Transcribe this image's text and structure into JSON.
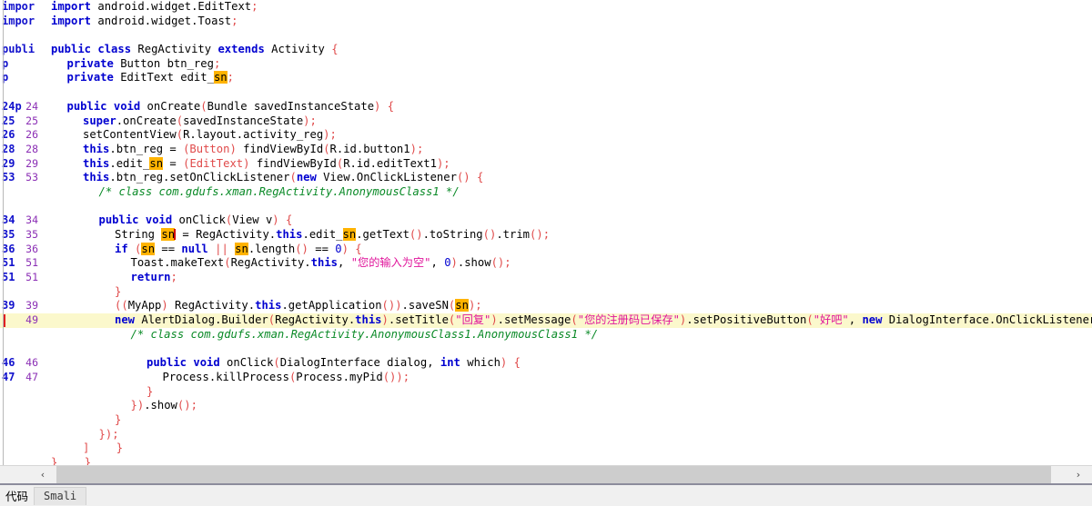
{
  "editor": {
    "ghost_gutter_lines": [
      "impor",
      "impor",
      "",
      "publi",
      "p",
      "p",
      "",
      "24p",
      "25",
      "26",
      "28",
      "29",
      "53",
      "",
      "",
      "34",
      "35",
      "36",
      "51",
      "51",
      "",
      "39",
      "49",
      "",
      "",
      "46",
      "47",
      "",
      "",
      "",
      "",
      "",
      "",
      ""
    ],
    "lines": [
      {
        "num": "",
        "indent": 0,
        "marker": false,
        "highlight": false,
        "tokens": [
          {
            "t": "kw",
            "v": "import"
          },
          {
            "t": "ident",
            "v": " android.widget.EditText"
          },
          {
            "t": "punc",
            "v": ";"
          }
        ]
      },
      {
        "num": "",
        "indent": 0,
        "marker": false,
        "highlight": false,
        "tokens": [
          {
            "t": "kw",
            "v": "import"
          },
          {
            "t": "ident",
            "v": " android.widget.Toast"
          },
          {
            "t": "punc",
            "v": ";"
          }
        ]
      },
      {
        "num": "",
        "indent": 0,
        "marker": false,
        "highlight": false,
        "tokens": []
      },
      {
        "num": "",
        "indent": 0,
        "marker": false,
        "highlight": false,
        "tokens": [
          {
            "t": "kw",
            "v": "public class"
          },
          {
            "t": "ident",
            "v": " RegActivity "
          },
          {
            "t": "kw",
            "v": "extends"
          },
          {
            "t": "ident",
            "v": " Activity "
          },
          {
            "t": "punc",
            "v": "{"
          }
        ]
      },
      {
        "num": "",
        "indent": 1,
        "marker": false,
        "highlight": false,
        "tokens": [
          {
            "t": "kw",
            "v": "private"
          },
          {
            "t": "ident",
            "v": " Button btn_reg"
          },
          {
            "t": "punc",
            "v": ";"
          }
        ]
      },
      {
        "num": "",
        "indent": 1,
        "marker": false,
        "highlight": false,
        "tokens": [
          {
            "t": "kw",
            "v": "private"
          },
          {
            "t": "ident",
            "v": " EditText edit_"
          },
          {
            "t": "hlvar",
            "v": "sn"
          },
          {
            "t": "punc",
            "v": ";"
          }
        ]
      },
      {
        "num": "",
        "indent": 0,
        "marker": false,
        "highlight": false,
        "tokens": []
      },
      {
        "num": "24",
        "indent": 1,
        "marker": false,
        "highlight": false,
        "tokens": [
          {
            "t": "kw",
            "v": "public void"
          },
          {
            "t": "ident",
            "v": " onCreate"
          },
          {
            "t": "punc",
            "v": "("
          },
          {
            "t": "ident",
            "v": "Bundle savedInstanceState"
          },
          {
            "t": "punc",
            "v": ")"
          },
          {
            "t": "ident",
            "v": " "
          },
          {
            "t": "punc",
            "v": "{"
          }
        ]
      },
      {
        "num": "25",
        "indent": 2,
        "marker": false,
        "highlight": false,
        "tokens": [
          {
            "t": "kw",
            "v": "super"
          },
          {
            "t": "ident",
            "v": ".onCreate"
          },
          {
            "t": "punc",
            "v": "("
          },
          {
            "t": "ident",
            "v": "savedInstanceState"
          },
          {
            "t": "punc",
            "v": ")"
          },
          {
            "t": "punc",
            "v": ";"
          }
        ]
      },
      {
        "num": "26",
        "indent": 2,
        "marker": false,
        "highlight": false,
        "tokens": [
          {
            "t": "ident",
            "v": "setContentView"
          },
          {
            "t": "punc",
            "v": "("
          },
          {
            "t": "ident",
            "v": "R.layout.activity_reg"
          },
          {
            "t": "punc",
            "v": ")"
          },
          {
            "t": "punc",
            "v": ";"
          }
        ]
      },
      {
        "num": "28",
        "indent": 2,
        "marker": false,
        "highlight": false,
        "tokens": [
          {
            "t": "kw",
            "v": "this"
          },
          {
            "t": "ident",
            "v": ".btn_reg = "
          },
          {
            "t": "punc",
            "v": "("
          },
          {
            "t": "punc",
            "v": "Button"
          },
          {
            "t": "punc",
            "v": ")"
          },
          {
            "t": "ident",
            "v": " findViewById"
          },
          {
            "t": "punc",
            "v": "("
          },
          {
            "t": "ident",
            "v": "R.id.button1"
          },
          {
            "t": "punc",
            "v": ")"
          },
          {
            "t": "punc",
            "v": ";"
          }
        ]
      },
      {
        "num": "29",
        "indent": 2,
        "marker": false,
        "highlight": false,
        "tokens": [
          {
            "t": "kw",
            "v": "this"
          },
          {
            "t": "ident",
            "v": ".edit_"
          },
          {
            "t": "hlvar",
            "v": "sn"
          },
          {
            "t": "ident",
            "v": " = "
          },
          {
            "t": "punc",
            "v": "("
          },
          {
            "t": "punc",
            "v": "EditText"
          },
          {
            "t": "punc",
            "v": ")"
          },
          {
            "t": "ident",
            "v": " findViewById"
          },
          {
            "t": "punc",
            "v": "("
          },
          {
            "t": "ident",
            "v": "R.id.editText1"
          },
          {
            "t": "punc",
            "v": ")"
          },
          {
            "t": "punc",
            "v": ";"
          }
        ]
      },
      {
        "num": "53",
        "indent": 2,
        "marker": false,
        "highlight": false,
        "tokens": [
          {
            "t": "kw",
            "v": "this"
          },
          {
            "t": "ident",
            "v": ".btn_reg.setOnClickListener"
          },
          {
            "t": "punc",
            "v": "("
          },
          {
            "t": "kw",
            "v": "new"
          },
          {
            "t": "ident",
            "v": " View.OnClickListener"
          },
          {
            "t": "punc",
            "v": "()"
          },
          {
            "t": "ident",
            "v": " "
          },
          {
            "t": "punc",
            "v": "{"
          }
        ]
      },
      {
        "num": "",
        "indent": 3,
        "marker": false,
        "highlight": false,
        "tokens": [
          {
            "t": "cmt",
            "v": "/* class com.gdufs.xman.RegActivity.AnonymousClass1 */"
          }
        ]
      },
      {
        "num": "",
        "indent": 0,
        "marker": false,
        "highlight": false,
        "tokens": []
      },
      {
        "num": "34",
        "indent": 3,
        "marker": false,
        "highlight": false,
        "tokens": [
          {
            "t": "kw",
            "v": "public void"
          },
          {
            "t": "ident",
            "v": " onClick"
          },
          {
            "t": "punc",
            "v": "("
          },
          {
            "t": "ident",
            "v": "View v"
          },
          {
            "t": "punc",
            "v": ")"
          },
          {
            "t": "ident",
            "v": " "
          },
          {
            "t": "punc",
            "v": "{"
          }
        ]
      },
      {
        "num": "35",
        "indent": 4,
        "marker": false,
        "highlight": false,
        "tokens": [
          {
            "t": "gold",
            "v": "String"
          },
          {
            "t": "ident",
            "v": " "
          },
          {
            "t": "hlvar",
            "v": "sn"
          },
          {
            "t": "caret",
            "v": ""
          },
          {
            "t": "ident",
            "v": " = RegActivity."
          },
          {
            "t": "kw",
            "v": "this"
          },
          {
            "t": "ident",
            "v": ".edit_"
          },
          {
            "t": "hlvar",
            "v": "sn"
          },
          {
            "t": "ident",
            "v": ".getText"
          },
          {
            "t": "punc",
            "v": "()"
          },
          {
            "t": "ident",
            "v": ".toString"
          },
          {
            "t": "punc",
            "v": "()"
          },
          {
            "t": "ident",
            "v": ".trim"
          },
          {
            "t": "punc",
            "v": "()"
          },
          {
            "t": "punc",
            "v": ";"
          }
        ]
      },
      {
        "num": "36",
        "indent": 4,
        "marker": false,
        "highlight": false,
        "tokens": [
          {
            "t": "kw",
            "v": "if"
          },
          {
            "t": "ident",
            "v": " "
          },
          {
            "t": "punc",
            "v": "("
          },
          {
            "t": "hlvar",
            "v": "sn"
          },
          {
            "t": "ident",
            "v": " == "
          },
          {
            "t": "kw",
            "v": "null"
          },
          {
            "t": "ident",
            "v": " "
          },
          {
            "t": "punc",
            "v": "||"
          },
          {
            "t": "ident",
            "v": " "
          },
          {
            "t": "hlvar",
            "v": "sn"
          },
          {
            "t": "ident",
            "v": ".length"
          },
          {
            "t": "punc",
            "v": "()"
          },
          {
            "t": "ident",
            "v": " == "
          },
          {
            "t": "num",
            "v": "0"
          },
          {
            "t": "punc",
            "v": ")"
          },
          {
            "t": "ident",
            "v": " "
          },
          {
            "t": "punc",
            "v": "{"
          }
        ]
      },
      {
        "num": "51",
        "indent": 5,
        "marker": false,
        "highlight": false,
        "tokens": [
          {
            "t": "ident",
            "v": "Toast.makeText"
          },
          {
            "t": "punc",
            "v": "("
          },
          {
            "t": "ident",
            "v": "RegActivity."
          },
          {
            "t": "kw",
            "v": "this"
          },
          {
            "t": "ident",
            "v": ", "
          },
          {
            "t": "str",
            "v": "\"您的输入为空\""
          },
          {
            "t": "ident",
            "v": ", "
          },
          {
            "t": "num",
            "v": "0"
          },
          {
            "t": "punc",
            "v": ")"
          },
          {
            "t": "ident",
            "v": ".show"
          },
          {
            "t": "punc",
            "v": "()"
          },
          {
            "t": "punc",
            "v": ";"
          }
        ]
      },
      {
        "num": "51",
        "indent": 5,
        "marker": false,
        "highlight": false,
        "tokens": [
          {
            "t": "kw",
            "v": "return"
          },
          {
            "t": "punc",
            "v": ";"
          }
        ]
      },
      {
        "num": "",
        "indent": 4,
        "marker": false,
        "highlight": false,
        "tokens": [
          {
            "t": "punc",
            "v": "}"
          }
        ]
      },
      {
        "num": "39",
        "indent": 4,
        "marker": false,
        "highlight": false,
        "tokens": [
          {
            "t": "punc",
            "v": "(("
          },
          {
            "t": "ident",
            "v": "MyApp"
          },
          {
            "t": "punc",
            "v": ")"
          },
          {
            "t": "ident",
            "v": " RegActivity."
          },
          {
            "t": "kw",
            "v": "this"
          },
          {
            "t": "ident",
            "v": ".getApplication"
          },
          {
            "t": "punc",
            "v": "())"
          },
          {
            "t": "ident",
            "v": ".saveSN"
          },
          {
            "t": "punc",
            "v": "("
          },
          {
            "t": "hlvar",
            "v": "sn"
          },
          {
            "t": "punc",
            "v": ")"
          },
          {
            "t": "punc",
            "v": ";"
          }
        ]
      },
      {
        "num": "49",
        "indent": 4,
        "marker": true,
        "highlight": true,
        "tokens": [
          {
            "t": "kw",
            "v": "new"
          },
          {
            "t": "ident",
            "v": " AlertDialog.Builder"
          },
          {
            "t": "punc",
            "v": "("
          },
          {
            "t": "ident",
            "v": "RegActivity."
          },
          {
            "t": "kw",
            "v": "this"
          },
          {
            "t": "punc",
            "v": ")"
          },
          {
            "t": "ident",
            "v": ".setTitle"
          },
          {
            "t": "punc",
            "v": "("
          },
          {
            "t": "str",
            "v": "\"回复\""
          },
          {
            "t": "punc",
            "v": ")"
          },
          {
            "t": "ident",
            "v": ".setMessage"
          },
          {
            "t": "punc",
            "v": "("
          },
          {
            "t": "str",
            "v": "\"您的注册码已保存\""
          },
          {
            "t": "punc",
            "v": ")"
          },
          {
            "t": "ident",
            "v": ".setPositiveButton"
          },
          {
            "t": "punc",
            "v": "("
          },
          {
            "t": "str",
            "v": "\"好吧\""
          },
          {
            "t": "ident",
            "v": ", "
          },
          {
            "t": "kw",
            "v": "new"
          },
          {
            "t": "ident",
            "v": " DialogInterface.OnClickListener"
          }
        ]
      },
      {
        "num": "",
        "indent": 5,
        "marker": false,
        "highlight": false,
        "tokens": [
          {
            "t": "cmt",
            "v": "/* class com.gdufs.xman.RegActivity.AnonymousClass1.AnonymousClass1 */"
          }
        ]
      },
      {
        "num": "",
        "indent": 0,
        "marker": false,
        "highlight": false,
        "tokens": []
      },
      {
        "num": "46",
        "indent": 6,
        "marker": false,
        "highlight": false,
        "tokens": [
          {
            "t": "kw",
            "v": "public void"
          },
          {
            "t": "ident",
            "v": " onClick"
          },
          {
            "t": "punc",
            "v": "("
          },
          {
            "t": "ident",
            "v": "DialogInterface dialog, "
          },
          {
            "t": "kw",
            "v": "int"
          },
          {
            "t": "ident",
            "v": " which"
          },
          {
            "t": "punc",
            "v": ")"
          },
          {
            "t": "ident",
            "v": " "
          },
          {
            "t": "punc",
            "v": "{"
          }
        ]
      },
      {
        "num": "47",
        "indent": 7,
        "marker": false,
        "highlight": false,
        "tokens": [
          {
            "t": "gold",
            "v": "Process"
          },
          {
            "t": "ident",
            "v": ".killProcess"
          },
          {
            "t": "punc",
            "v": "("
          },
          {
            "t": "gold",
            "v": "Process"
          },
          {
            "t": "ident",
            "v": ".myPid"
          },
          {
            "t": "punc",
            "v": "())"
          },
          {
            "t": "punc",
            "v": ";"
          }
        ]
      },
      {
        "num": "",
        "indent": 6,
        "marker": false,
        "highlight": false,
        "tokens": [
          {
            "t": "punc",
            "v": "}"
          }
        ]
      },
      {
        "num": "",
        "indent": 5,
        "marker": false,
        "highlight": false,
        "tokens": [
          {
            "t": "punc",
            "v": "})"
          },
          {
            "t": "ident",
            "v": ".show"
          },
          {
            "t": "punc",
            "v": "()"
          },
          {
            "t": "punc",
            "v": ";"
          }
        ]
      },
      {
        "num": "",
        "indent": 4,
        "marker": false,
        "highlight": false,
        "tokens": [
          {
            "t": "punc",
            "v": "}"
          }
        ]
      },
      {
        "num": "",
        "indent": 3,
        "marker": false,
        "highlight": false,
        "tokens": [
          {
            "t": "punc",
            "v": "})"
          },
          {
            "t": "punc",
            "v": ";"
          }
        ]
      },
      {
        "num": "",
        "indent": 2,
        "marker": false,
        "highlight": false,
        "tokens": [
          {
            "t": "punc",
            "v": "]"
          },
          {
            "t": "ident",
            "v": "    "
          },
          {
            "t": "punc",
            "v": "}"
          }
        ]
      },
      {
        "num": "",
        "indent": 0,
        "marker": false,
        "highlight": false,
        "tokens": [
          {
            "t": "punc",
            "v": "}"
          },
          {
            "t": "ident",
            "v": "    "
          },
          {
            "t": "punc",
            "v": "}"
          }
        ]
      }
    ]
  },
  "scrollbar": {
    "left_arrow": "‹",
    "right_arrow": "›"
  },
  "tabbar": {
    "label": "代码",
    "tabs": [
      {
        "label": "Smali"
      }
    ]
  }
}
